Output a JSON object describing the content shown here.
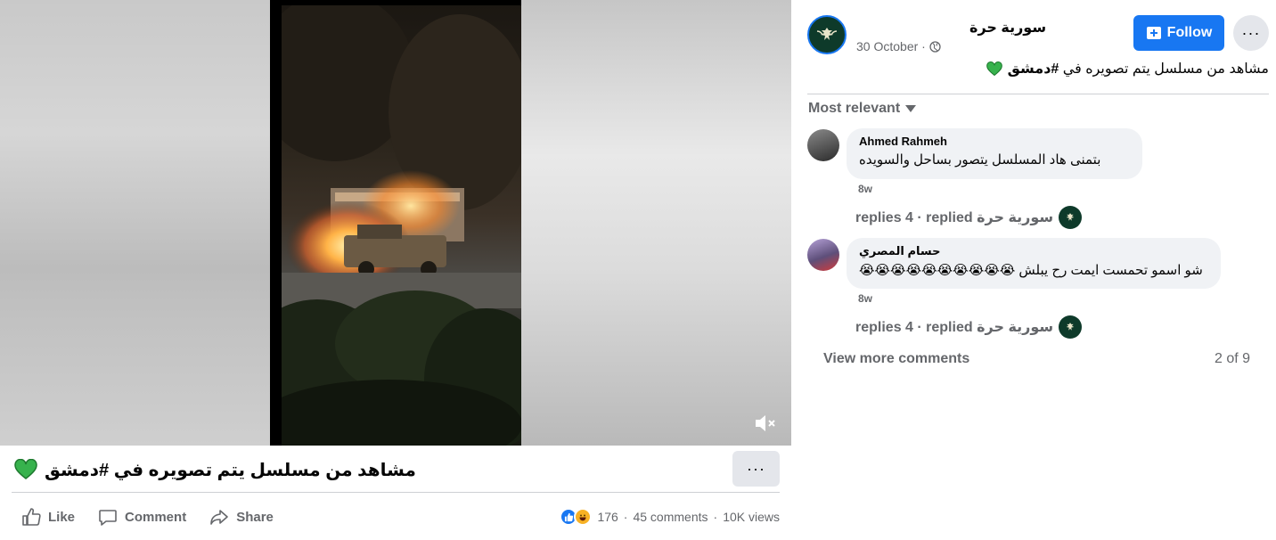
{
  "video": {
    "mute_icon": "speaker-muted-icon"
  },
  "post": {
    "caption": "مشاهد من مسلسل يتم تصويره في #دمشق",
    "caption_emoji": "💚",
    "more_label": "···"
  },
  "actions": {
    "like": "Like",
    "comment": "Comment",
    "share": "Share"
  },
  "stats": {
    "reactions": "176",
    "sep1": "·",
    "comments": "45 comments",
    "sep2": "·",
    "views": "10K views"
  },
  "page": {
    "name": "سورية حرة",
    "date": "30 October ·",
    "follow_label": "Follow",
    "more_label": "···",
    "caption_plain": "مشاهد من مسلسل يتم تصويره في ",
    "caption_hashtag": "#دمشق",
    "accent": "#1877f2"
  },
  "comments": {
    "sort_label": "Most relevant",
    "items": [
      {
        "author": "Ahmed Rahmeh",
        "text": "بتمنى هاد المسلسل يتصور بساحل والسويده",
        "time": "8w",
        "replies": "replies 4 · replied سورية حرة"
      },
      {
        "author": "حسام المصري",
        "text": "شو اسمو تحمست ايمت رح يبلش 😭😭😭😭😭😭😭😭😭😭",
        "time": "8w",
        "replies": "replies 4 · replied سورية حرة"
      }
    ],
    "view_more": "View more comments",
    "pager": "2 of 9"
  }
}
